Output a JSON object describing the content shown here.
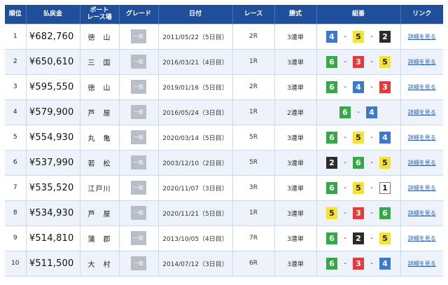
{
  "headers": [
    "順位",
    "払戻金",
    "ボート\nレース場",
    "グレード",
    "日付",
    "レース",
    "勝式",
    "組番",
    "リンク"
  ],
  "rows": [
    {
      "rank": "1",
      "payout": "¥682,760",
      "venue": "徳　山",
      "grade": "一般",
      "date": "2011/05/22（5日目）",
      "race": "2R",
      "kind": "3連単",
      "combo": [
        "4",
        "5",
        "2"
      ],
      "link": "詳細を見る"
    },
    {
      "rank": "2",
      "payout": "¥650,610",
      "venue": "三　国",
      "grade": "一般",
      "date": "2016/03/21（4日目）",
      "race": "1R",
      "kind": "3連単",
      "combo": [
        "6",
        "3",
        "5"
      ],
      "link": "詳細を見る"
    },
    {
      "rank": "3",
      "payout": "¥595,550",
      "venue": "徳　山",
      "grade": "一般",
      "date": "2019/01/16（5日目）",
      "race": "2R",
      "kind": "3連単",
      "combo": [
        "6",
        "4",
        "3"
      ],
      "link": "詳細を見る"
    },
    {
      "rank": "4",
      "payout": "¥579,900",
      "venue": "芦　屋",
      "grade": "一般",
      "date": "2016/05/24（3日目）",
      "race": "1R",
      "kind": "2連単",
      "combo": [
        "6",
        "4"
      ],
      "link": "詳細を見る"
    },
    {
      "rank": "5",
      "payout": "¥554,930",
      "venue": "丸　亀",
      "grade": "一般",
      "date": "2020/03/14（5日目）",
      "race": "5R",
      "kind": "3連単",
      "combo": [
        "6",
        "5",
        "4"
      ],
      "link": "詳細を見る"
    },
    {
      "rank": "6",
      "payout": "¥537,990",
      "venue": "若　松",
      "grade": "一般",
      "date": "2003/12/10（2日目）",
      "race": "5R",
      "kind": "3連単",
      "combo": [
        "2",
        "6",
        "5"
      ],
      "link": "詳細を見る"
    },
    {
      "rank": "7",
      "payout": "¥535,520",
      "venue": "江戸川",
      "grade": "一般",
      "date": "2020/11/07（3日目）",
      "race": "3R",
      "kind": "3連単",
      "combo": [
        "6",
        "5",
        "1"
      ],
      "link": "詳細を見る"
    },
    {
      "rank": "8",
      "payout": "¥534,930",
      "venue": "芦　屋",
      "grade": "一般",
      "date": "2020/11/21（5日目）",
      "race": "1R",
      "kind": "3連単",
      "combo": [
        "5",
        "3",
        "6"
      ],
      "link": "詳細を見る"
    },
    {
      "rank": "9",
      "payout": "¥514,810",
      "venue": "蒲　郡",
      "grade": "一般",
      "date": "2013/10/05（4日目）",
      "race": "7R",
      "kind": "3連単",
      "combo": [
        "6",
        "2",
        "5"
      ],
      "link": "詳細を見る"
    },
    {
      "rank": "10",
      "payout": "¥511,500",
      "venue": "大　村",
      "grade": "一般",
      "date": "2014/07/12（3日目）",
      "race": "6R",
      "kind": "3連単",
      "combo": [
        "6",
        "3",
        "4"
      ],
      "link": "詳細を見る"
    }
  ],
  "separator": "-",
  "colors": {
    "header_bg": "#1f4f9a",
    "boat_1": "#ffffff",
    "boat_2": "#2c2c2c",
    "boat_3": "#e23b3b",
    "boat_4": "#3f78c9",
    "boat_5": "#f2e23a",
    "boat_6": "#3aa64a",
    "link": "#2a5db0"
  }
}
